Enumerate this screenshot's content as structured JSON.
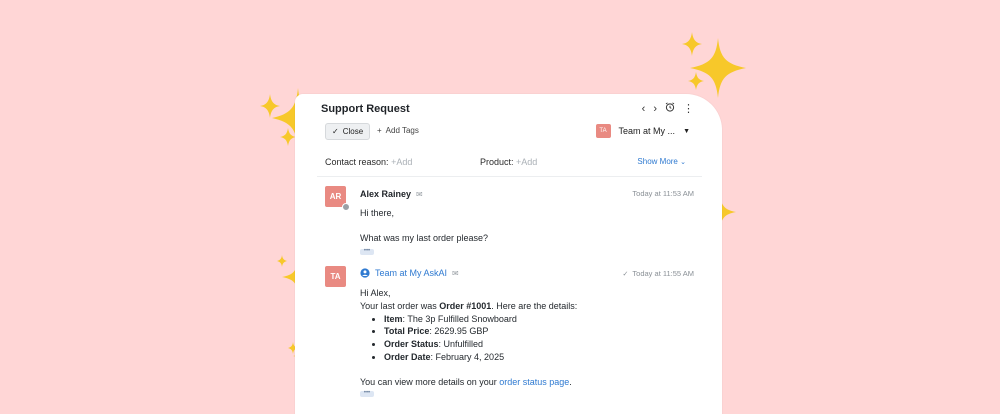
{
  "ticket": {
    "title": "Support Request",
    "close_label": "Close",
    "add_tags_label": "Add Tags",
    "assignee_initials": "TA",
    "assignee_name": "Team at My ..."
  },
  "fields": {
    "contact_reason_label": "Contact reason:",
    "contact_reason_value": "+Add",
    "product_label": "Product:",
    "product_value": "+Add",
    "show_more_label": "Show More"
  },
  "messages": [
    {
      "initials": "AR",
      "author": "Alex Rainey",
      "time": "Today at 11:53 AM",
      "line1": "Hi there,",
      "line2": "What was my last order please?",
      "more": "•••"
    },
    {
      "initials": "TA",
      "author": "Team at My AskAI",
      "time": "Today at 11:55 AM",
      "greeting": "Hi Alex,",
      "intro_before": "Your last order was ",
      "intro_order": "Order #1001",
      "intro_after": ". Here are the details:",
      "details": [
        {
          "label": "Item",
          "value": ": The 3p Fulfilled Snowboard"
        },
        {
          "label": "Total Price",
          "value": ": 2629.95 GBP"
        },
        {
          "label": "Order Status",
          "value": ": Unfulfilled"
        },
        {
          "label": "Order Date",
          "value": ": February 4, 2025"
        }
      ],
      "outro_before": "You can view more details on your ",
      "outro_link": "order status page",
      "outro_after": ".",
      "more": "•••"
    }
  ],
  "colors": {
    "background": "#ffd6d6",
    "avatar": "#e98a82",
    "link": "#2f7ad1",
    "sparkle": "#f7c82a"
  },
  "icons": [
    "chevron-left-icon",
    "chevron-right-icon",
    "alarm-icon",
    "more-vertical-icon",
    "check-icon",
    "plus-icon",
    "caret-down-icon",
    "envelope-icon",
    "user-circle-icon",
    "sparkle-icon"
  ]
}
